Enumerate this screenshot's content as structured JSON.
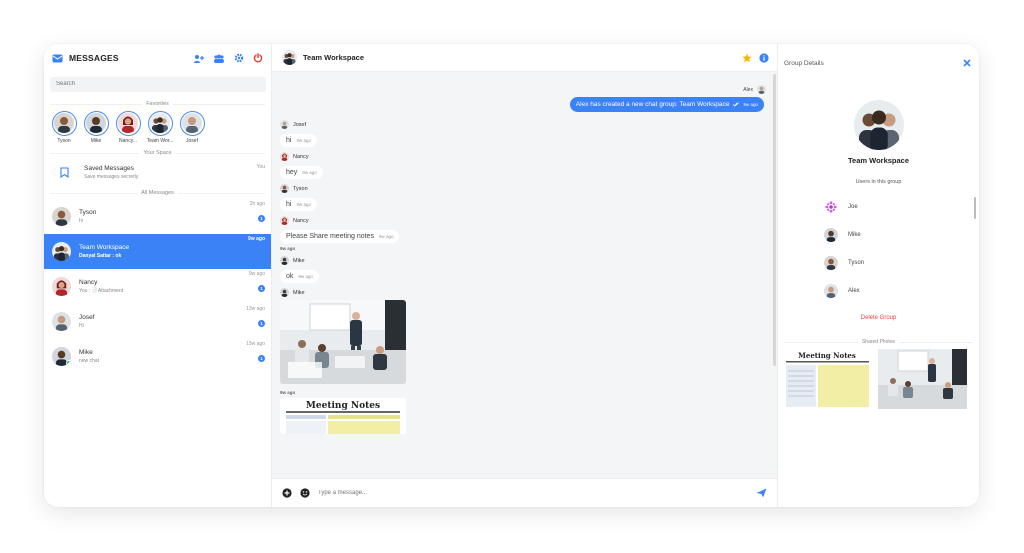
{
  "colors": {
    "accent": "#3b82f6",
    "danger": "#ef4444",
    "star": "#f5b800",
    "online": "#22c55e"
  },
  "sidebar": {
    "title": "MESSAGES",
    "search_placeholder": "Search",
    "favorites_label": "Favorites",
    "favorites": [
      {
        "name": "Tyson"
      },
      {
        "name": "Mike"
      },
      {
        "name": "Nancy..."
      },
      {
        "name": "Team Wor..."
      },
      {
        "name": "Josef"
      }
    ],
    "your_space_label": "Your Space",
    "saved": {
      "name": "Saved Messages",
      "sub": "Save messages secretly",
      "time": "You"
    },
    "all_messages_label": "All Messages",
    "conversations": [
      {
        "name": "Tyson",
        "sub": "hi",
        "time": "2h ago",
        "badge": "1"
      },
      {
        "name": "Team Workspace",
        "sub": "Danyal Sattar : ok",
        "time": "9w ago",
        "badge": ""
      },
      {
        "name": "Nancy",
        "sub": "You : 📄Attachment",
        "time": "9w ago",
        "badge": "1"
      },
      {
        "name": "Josef",
        "sub": "Hi",
        "time": "13w ago",
        "badge": "1"
      },
      {
        "name": "Mike",
        "sub": "new chat",
        "time": "15w ago",
        "badge": "1"
      }
    ]
  },
  "chat": {
    "title": "Team Workspace",
    "me_name": "Alex",
    "system_message": "Alex has created a new chat group: Team Workspace",
    "system_time": "9w ago",
    "messages": [
      {
        "sender": "Josef",
        "text": "hi",
        "time": "9w ago"
      },
      {
        "sender": "Nancy",
        "text": "hey",
        "time": "9w ago"
      },
      {
        "sender": "Tyson",
        "text": "hi",
        "time": "9w ago"
      },
      {
        "sender": "Nancy",
        "text": "Please Share meeting notes",
        "time": "9w ago"
      },
      {
        "sender": "Mike",
        "text": "ok",
        "time": "9w ago"
      },
      {
        "sender": "Mike"
      }
    ],
    "time_label": "9w ago",
    "notes_title": "Meeting Notes",
    "composer_placeholder": "Type a message..."
  },
  "details": {
    "title": "Group Details",
    "group_name": "Team Workspace",
    "users_label": "Users in this group",
    "users": [
      {
        "name": "Joe"
      },
      {
        "name": "Mike"
      },
      {
        "name": "Tyson"
      },
      {
        "name": "Alex"
      }
    ],
    "delete_label": "Delete Group",
    "shared_label": "Shared Photos",
    "notes_title": "Meeting Notes"
  }
}
